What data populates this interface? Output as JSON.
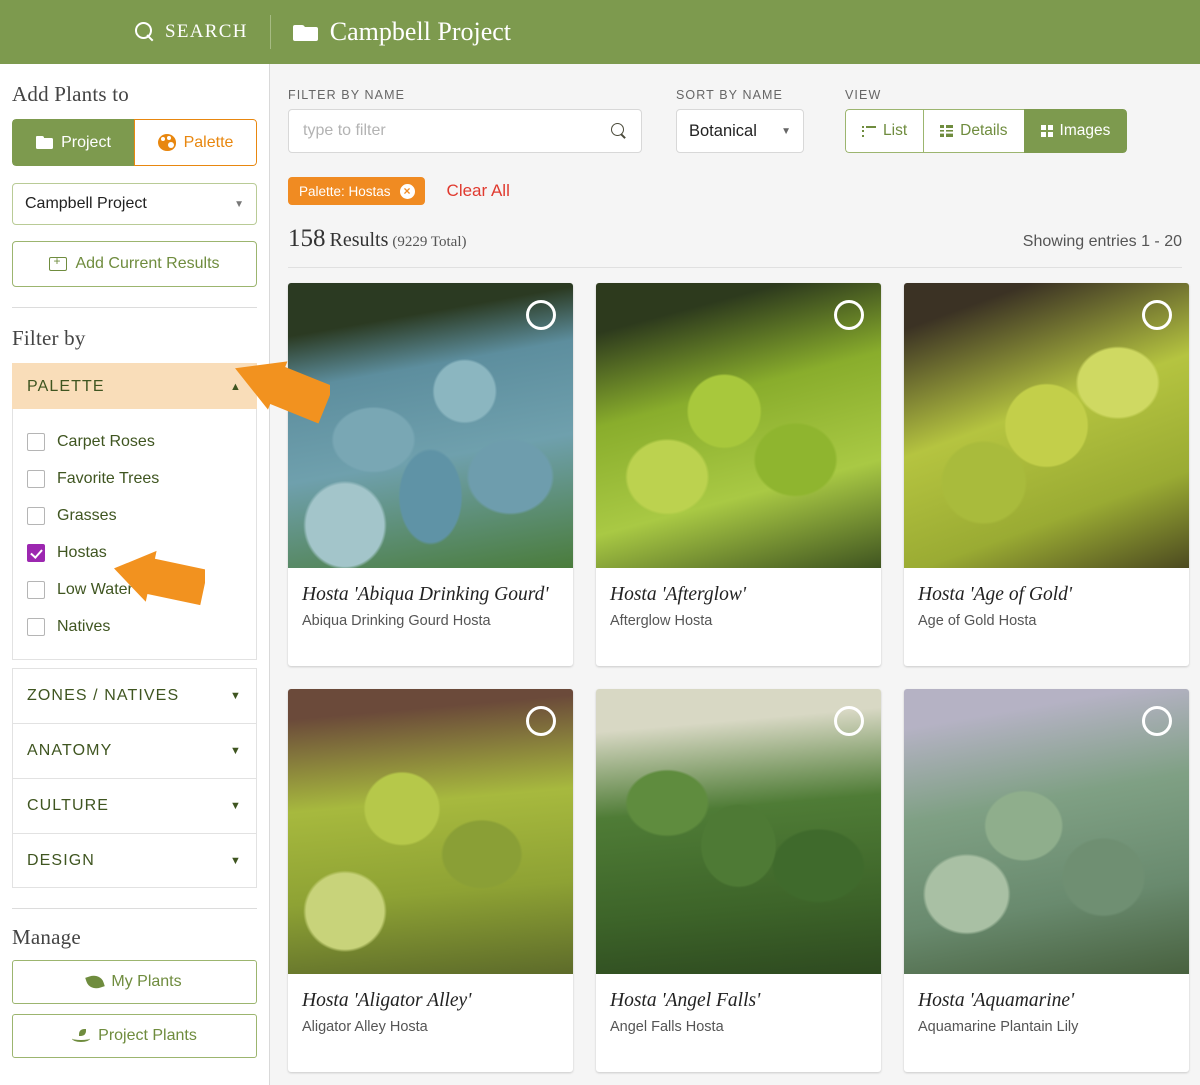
{
  "header": {
    "search_label": "SEARCH",
    "search_icon": "search-icon",
    "project_icon": "folder-icon",
    "project_name": "Campbell Project"
  },
  "sidebar": {
    "add_plants_title": "Add Plants to",
    "add_target_toggle": [
      {
        "label": "Project",
        "icon": "folder-icon",
        "active": true
      },
      {
        "label": "Palette",
        "icon": "palette-icon",
        "active": false
      }
    ],
    "project_select_value": "Campbell Project",
    "add_results_label": "Add Current Results",
    "add_results_icon": "folder-plus-icon",
    "filter_by_title": "Filter by",
    "palette_section": {
      "title": "PALETTE",
      "expanded": true,
      "caret": "▲",
      "items": [
        {
          "label": "Carpet Roses",
          "checked": false
        },
        {
          "label": "Favorite Trees",
          "checked": false
        },
        {
          "label": "Grasses",
          "checked": false
        },
        {
          "label": "Hostas",
          "checked": true
        },
        {
          "label": "Low Water",
          "checked": false
        },
        {
          "label": "Natives",
          "checked": false
        }
      ]
    },
    "collapsed_sections": [
      {
        "title": "ZONES / NATIVES",
        "caret": "▼"
      },
      {
        "title": "ANATOMY",
        "caret": "▼"
      },
      {
        "title": "CULTURE",
        "caret": "▼"
      },
      {
        "title": "DESIGN",
        "caret": "▼"
      }
    ],
    "manage_title": "Manage",
    "manage_buttons": [
      {
        "label": "My Plants",
        "icon": "leaf-icon"
      },
      {
        "label": "Project Plants",
        "icon": "sprout-icon"
      }
    ]
  },
  "toolbar": {
    "filter_label": "FILTER BY NAME",
    "filter_placeholder": "type to filter",
    "filter_value": "",
    "filter_icon": "search-icon",
    "sort_label": "SORT BY NAME",
    "sort_value": "Botanical",
    "view_label": "VIEW",
    "view_options": [
      {
        "label": "List",
        "icon": "list-icon",
        "active": false
      },
      {
        "label": "Details",
        "icon": "details-icon",
        "active": false
      },
      {
        "label": "Images",
        "icon": "grid-icon",
        "active": true
      }
    ]
  },
  "filters": {
    "active_tag": "Palette: Hostas",
    "tag_remove_icon": "close-circle-icon",
    "clear_all": "Clear All"
  },
  "results": {
    "count": "158",
    "count_word": "Results",
    "total": "(9229 Total)",
    "showing": "Showing entries 1 - 20"
  },
  "cards": [
    {
      "botanical": "Hosta 'Abiqua Drinking Gourd'",
      "common": "Abiqua Drinking Gourd Hosta",
      "photo": "ph1"
    },
    {
      "botanical": "Hosta 'Afterglow'",
      "common": "Afterglow Hosta",
      "photo": "ph2"
    },
    {
      "botanical": "Hosta 'Age of Gold'",
      "common": "Age of Gold Hosta",
      "photo": "ph3"
    },
    {
      "botanical": "Hosta 'Aligator Alley'",
      "common": "Aligator Alley Hosta",
      "photo": "ph4"
    },
    {
      "botanical": "Hosta 'Angel Falls'",
      "common": "Angel Falls Hosta",
      "photo": "ph5"
    },
    {
      "botanical": "Hosta 'Aquamarine'",
      "common": "Aquamarine Plantain Lily",
      "photo": "ph6"
    }
  ],
  "colors": {
    "brand_green": "#7d9a4e",
    "accent_orange": "#f08b22",
    "clear_red": "#e03a2f",
    "checkbox_purple": "#9c27b0",
    "palette_header_bg": "#f9ddb9",
    "annotation_orange": "#f2921f"
  }
}
